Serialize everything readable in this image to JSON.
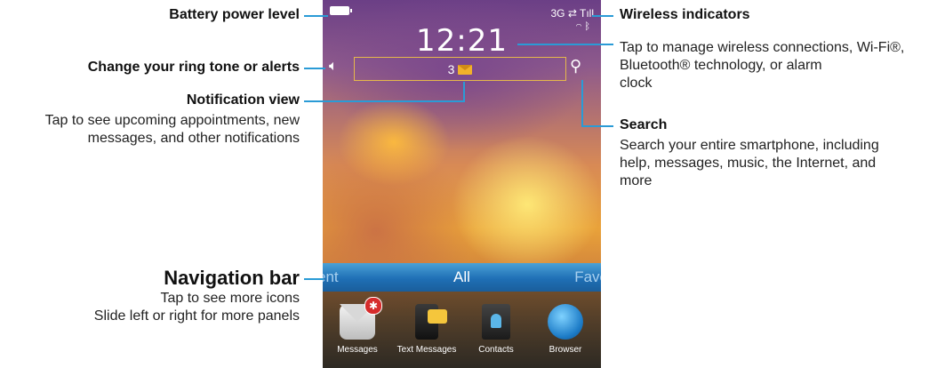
{
  "phone": {
    "network": "3G",
    "signal_glyph": "Tıll",
    "clock": "12:21",
    "notification_count": "3",
    "nav_left": "ent",
    "nav_center": "All",
    "nav_right": "Favo",
    "apps": [
      {
        "label": "Messages",
        "icon": "envelope-icon",
        "badge": "✱"
      },
      {
        "label": "Text Messages",
        "icon": "text-messages-icon"
      },
      {
        "label": "Contacts",
        "icon": "contacts-icon"
      },
      {
        "label": "Browser",
        "icon": "globe-icon"
      }
    ]
  },
  "callouts": {
    "battery": "Battery power level",
    "ringtone": "Change your ring tone or alerts",
    "notification_title": "Notification view",
    "notification_desc_1": "Tap to see upcoming appointments, new",
    "notification_desc_2": "messages, and other notifications",
    "navbar_title": "Navigation bar",
    "navbar_desc_1": "Tap to see more icons",
    "navbar_desc_2": "Slide left or right for more panels",
    "wireless_title": "Wireless indicators",
    "wireless_desc_1": "Tap to manage wireless connections, Wi-Fi®,",
    "wireless_desc_2": "Bluetooth® technology, or alarm",
    "wireless_desc_3": "clock",
    "search_title": "Search",
    "search_desc_1": "Search your entire smartphone, including",
    "search_desc_2": "help, messages, music, the Internet, and",
    "search_desc_3": "more"
  },
  "colors": {
    "accent_line": "#2a9bd6",
    "navbar": "#1f6fb5"
  }
}
